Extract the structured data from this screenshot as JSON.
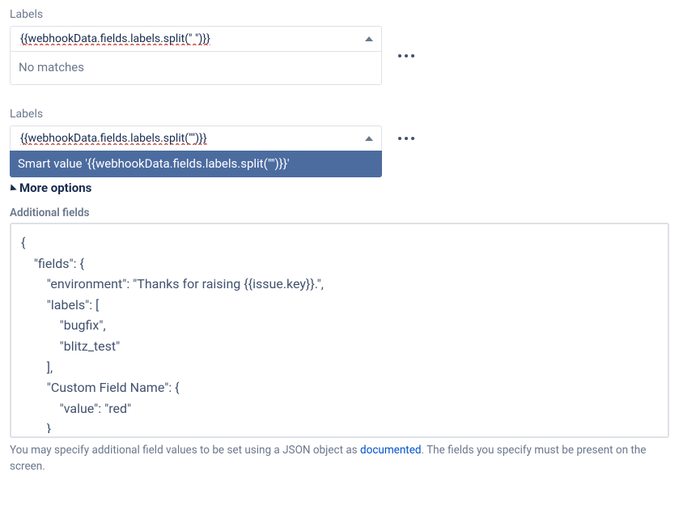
{
  "block1": {
    "heading": "Labels",
    "input_value": "{{webhookData.fields.labels.split(\" \")}}",
    "no_matches": "No matches"
  },
  "block2": {
    "heading": "Labels",
    "input_value": "{{webhookData.fields.labels.split(\"\")}}",
    "suggestion": "Smart value '{{webhookData.fields.labels.split(\"\")}}'"
  },
  "more_options": "More options",
  "additional": {
    "heading": "Additional fields",
    "json": "{\n    \"fields\": {\n        \"environment\": \"Thanks for raising {{issue.key}}.\",\n        \"labels\": [\n            \"bugfix\",\n            \"blitz_test\"\n        ],\n        \"Custom Field Name\": {\n            \"value\": \"red\"\n        }",
    "helper_before": "You may specify additional field values to be set using a JSON object as ",
    "helper_link": "documented",
    "helper_after": ". The fields you specify must be present on the screen."
  }
}
